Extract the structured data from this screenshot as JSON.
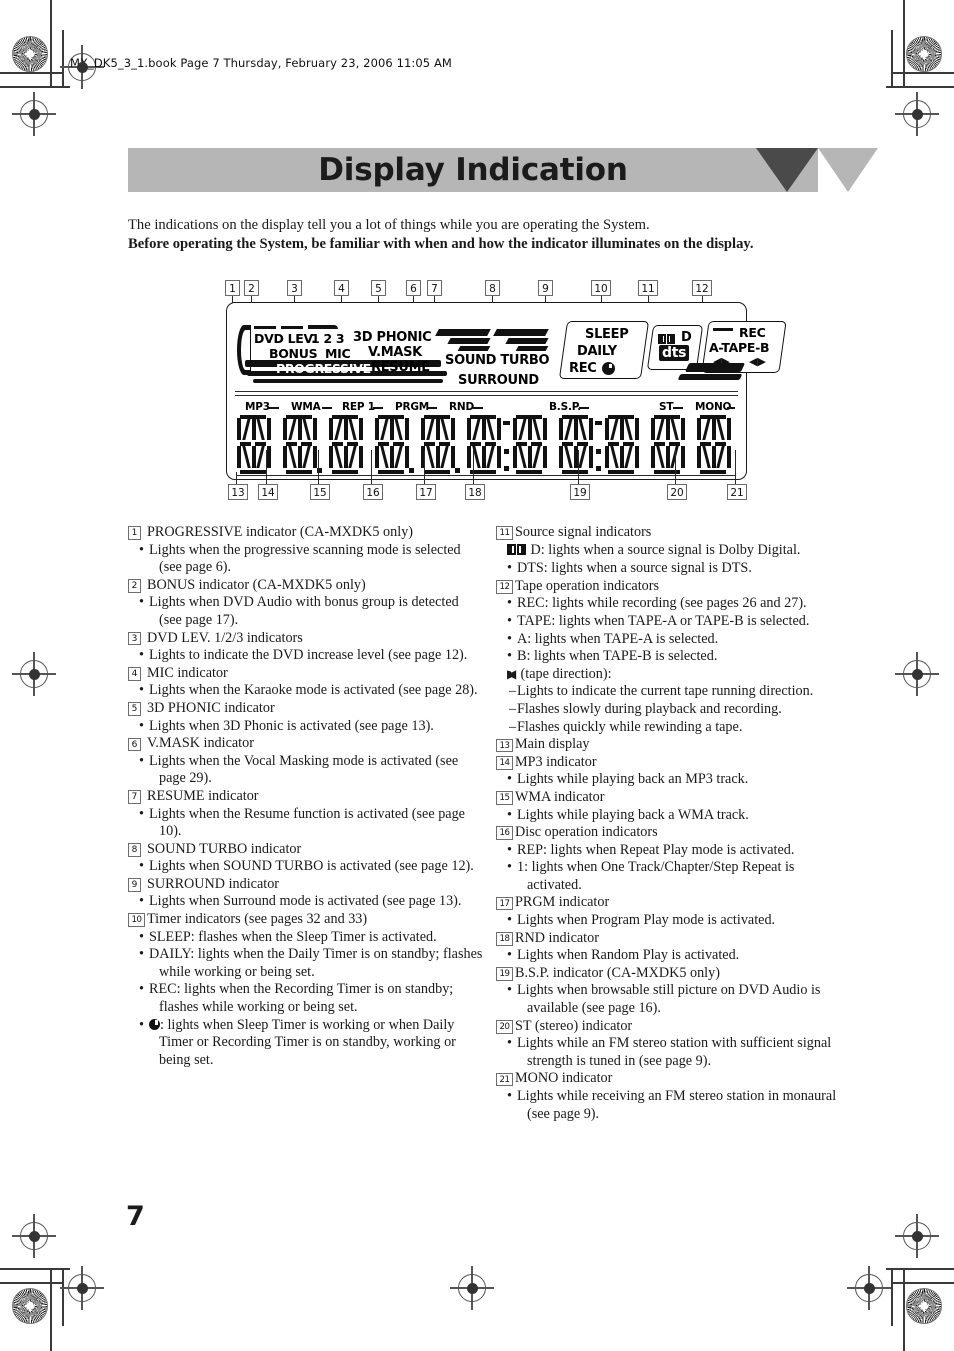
{
  "header": {
    "file_line": "MX_DK5_3_1.book  Page 7  Thursday, February 23, 2006  11:05 AM"
  },
  "title": "Display Indication",
  "intro": {
    "line1": "The indications on the display tell you a lot of things while you are operating the System.",
    "line2": "Before operating the System, be familiar with when and how the indicator illuminates on the display."
  },
  "diagram": {
    "top_callouts": [
      "1",
      "2",
      "3",
      "4",
      "5",
      "6",
      "7",
      "8",
      "9",
      "10",
      "11",
      "12"
    ],
    "bottom_callouts": [
      "13",
      "14",
      "15",
      "16",
      "17",
      "18",
      "19",
      "20",
      "21"
    ],
    "panel_labels": {
      "dvd_lev": "DVD LEV.",
      "dvd_lev_nums": "1 2 3",
      "bonus": "BONUS",
      "mic": "MIC",
      "progressive": "PROGRESSIVE",
      "phonic": "3D PHONIC",
      "vmask": "V.MASK",
      "resume": "RESUME",
      "sound_turbo": "SOUND TURBO",
      "surround": "SURROUND",
      "sleep": "SLEEP",
      "daily": "DAILY",
      "rec_timer": "REC",
      "dolby": "D",
      "dts": "dts",
      "rec_tape": "REC",
      "a_tape_b": "A-TAPE-B"
    },
    "segment_labels": {
      "mp3": "MP3",
      "wma": "WMA",
      "rep1": "REP 1",
      "prgm": "PRGM",
      "rnd": "RND",
      "bsp": "B.S.P.",
      "st": "ST",
      "mono": "MONO"
    }
  },
  "left_column": [
    {
      "num": "1",
      "head": "PROGRESSIVE indicator (CA-MXDK5 only)",
      "bullets": [
        "Lights when the progressive scanning mode is selected (see page 6)."
      ]
    },
    {
      "num": "2",
      "head": "BONUS indicator (CA-MXDK5 only)",
      "bullets": [
        "Lights when DVD Audio with bonus group is detected (see page 17)."
      ]
    },
    {
      "num": "3",
      "head": "DVD LEV. 1/2/3 indicators",
      "bullets": [
        "Lights to indicate the DVD increase level (see page 12)."
      ]
    },
    {
      "num": "4",
      "head": "MIC indicator",
      "bullets": [
        "Lights when the Karaoke mode is activated (see page 28)."
      ]
    },
    {
      "num": "5",
      "head": "3D PHONIC indicator",
      "bullets": [
        "Lights when 3D Phonic is activated (see page 13)."
      ]
    },
    {
      "num": "6",
      "head": "V.MASK indicator",
      "bullets": [
        "Lights when the Vocal Masking mode is activated (see page 29)."
      ]
    },
    {
      "num": "7",
      "head": "RESUME indicator",
      "bullets": [
        "Lights when the Resume function is activated (see page 10)."
      ]
    },
    {
      "num": "8",
      "head": "SOUND TURBO indicator",
      "bullets": [
        "Lights when SOUND TURBO is activated (see page 12)."
      ]
    },
    {
      "num": "9",
      "head": "SURROUND indicator",
      "bullets": [
        "Lights when Surround mode is activated (see page 13)."
      ]
    },
    {
      "num": "10",
      "head": "Timer indicators (see pages 32 and 33)",
      "bullets": [
        "SLEEP: flashes when the Sleep Timer is activated.",
        "DAILY: lights when the Daily Timer is on standby; flashes while working or being set.",
        "REC: lights when the Recording Timer is on standby; flashes while working or being set."
      ],
      "clock_bullet": ": lights when Sleep Timer is working or when Daily Timer or Recording Timer is on standby, working or being set."
    }
  ],
  "right_column": [
    {
      "num": "11",
      "head": "Source signal indicators",
      "dolby_bullet": "D: lights when a source signal is Dolby Digital.",
      "bullets": [
        "DTS: lights when a source signal is DTS."
      ]
    },
    {
      "num": "12",
      "head": "Tape operation indicators",
      "bullets": [
        "REC: lights while recording (see pages 26 and 27).",
        "TAPE: lights when TAPE-A or TAPE-B is selected.",
        "A: lights when TAPE-A is selected.",
        "B: lights when TAPE-B is selected."
      ],
      "direction_bullet": "(tape direction):",
      "dashes": [
        "Lights to indicate the current tape running direction.",
        "Flashes slowly during playback and recording.",
        "Flashes quickly while rewinding a tape."
      ]
    },
    {
      "num": "13",
      "head": "Main display",
      "bullets": []
    },
    {
      "num": "14",
      "head": "MP3 indicator",
      "bullets": [
        "Lights while playing back an MP3 track."
      ]
    },
    {
      "num": "15",
      "head": "WMA indicator",
      "bullets": [
        "Lights while playing back a WMA track."
      ]
    },
    {
      "num": "16",
      "head": "Disc operation indicators",
      "bullets": [
        "REP: lights when Repeat Play mode is activated.",
        "1: lights when One Track/Chapter/Step Repeat is activated."
      ]
    },
    {
      "num": "17",
      "head": "PRGM indicator",
      "bullets": [
        "Lights when Program Play mode is activated."
      ]
    },
    {
      "num": "18",
      "head": "RND indicator",
      "bullets": [
        "Lights when Random Play is activated."
      ]
    },
    {
      "num": "19",
      "head": "B.S.P. indicator (CA-MXDK5 only)",
      "bullets": [
        "Lights when browsable still picture on DVD Audio is available (see page 16)."
      ]
    },
    {
      "num": "20",
      "head": "ST (stereo) indicator",
      "bullets": [
        "Lights while an FM stereo station with sufficient signal strength is tuned in (see page 9)."
      ]
    },
    {
      "num": "21",
      "head": "MONO indicator",
      "bullets": [
        "Lights while receiving an FM stereo station in monaural (see page 9)."
      ]
    }
  ],
  "page_number": "7"
}
